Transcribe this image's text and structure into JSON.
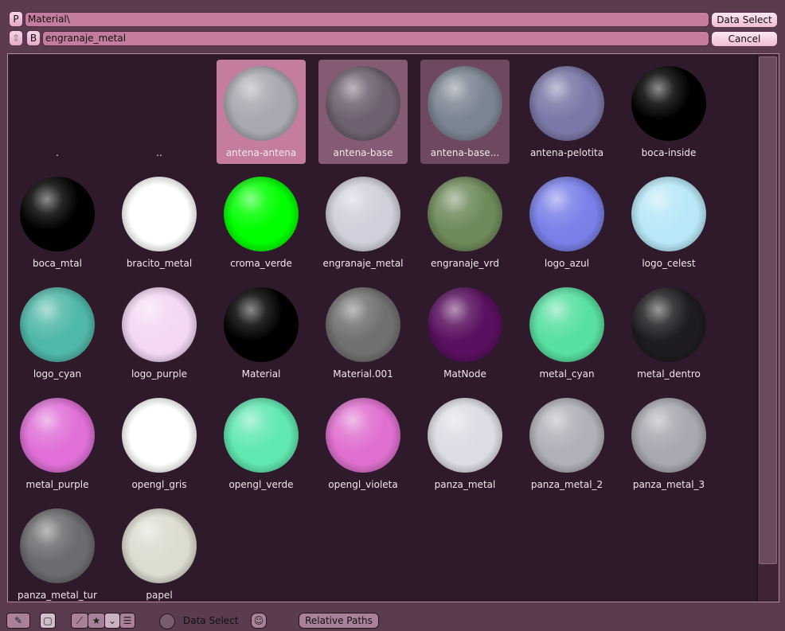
{
  "header": {
    "dir_button": "P",
    "dir_path": "Material\\",
    "data_select_label": "Data Select",
    "browse_button": "B",
    "file_name": "engranaje_metal",
    "cancel_label": "Cancel"
  },
  "items": [
    {
      "label": ".",
      "icon": "folder-current-icon"
    },
    {
      "label": "..",
      "icon": "folder-parent-icon"
    },
    {
      "label": "antena-antena",
      "selected": true,
      "color": "#a8a8b0"
    },
    {
      "label": "antena-base",
      "selected": true,
      "color": "#6e6070"
    },
    {
      "label": "antena-base...",
      "selected": true,
      "color": "#7b8592"
    },
    {
      "label": "antena-pelotita",
      "color": "#7a78a8"
    },
    {
      "label": "boca-inside",
      "color": "#000000"
    },
    {
      "label": "boca_mtal",
      "color": "#000000"
    },
    {
      "label": "bracito_metal",
      "color": "#ffffff"
    },
    {
      "label": "croma_verde",
      "color": "#00ff00"
    },
    {
      "label": "engranaje_metal",
      "color": "#d0d0dc"
    },
    {
      "label": "engranaje_vrd",
      "color": "#6e8a5a"
    },
    {
      "label": "logo_azul",
      "color": "#7a80e8"
    },
    {
      "label": "logo_celest",
      "color": "#b8e8f8"
    },
    {
      "label": "logo_cyan",
      "color": "#50b8a8"
    },
    {
      "label": "logo_purple",
      "color": "#f4d8f4"
    },
    {
      "label": "Material",
      "color": "#000000"
    },
    {
      "label": "Material.001",
      "color": "#707070"
    },
    {
      "label": "MatNode",
      "color": "#5a1060"
    },
    {
      "label": "metal_cyan",
      "color": "#58e0a0"
    },
    {
      "label": "metal_dentro",
      "color": "#1e1c20"
    },
    {
      "label": "metal_purple",
      "color": "#e070d8"
    },
    {
      "label": "opengl_gris",
      "color": "#ffffff"
    },
    {
      "label": "opengl_verde",
      "color": "#60e8b0"
    },
    {
      "label": "opengl_violeta",
      "color": "#e070d0"
    },
    {
      "label": "panza_metal",
      "color": "#dcdce4"
    },
    {
      "label": "panza_metal_2",
      "color": "#b0b0b8"
    },
    {
      "label": "panza_metal_3",
      "color": "#a8a8b0"
    },
    {
      "label": "panza_metal_tur",
      "color": "#6c6c70"
    },
    {
      "label": "papel",
      "color": "#dcdcd0"
    }
  ],
  "toolbar": {
    "data_select_label": "Data Select",
    "relative_paths_label": "Relative Paths",
    "icons": [
      "eye-dropper-icon",
      "square-icon",
      "sort-alpha-icon",
      "sort-star-icon",
      "sort-down-icon",
      "sort-list-icon",
      "ghost-icon"
    ]
  }
}
